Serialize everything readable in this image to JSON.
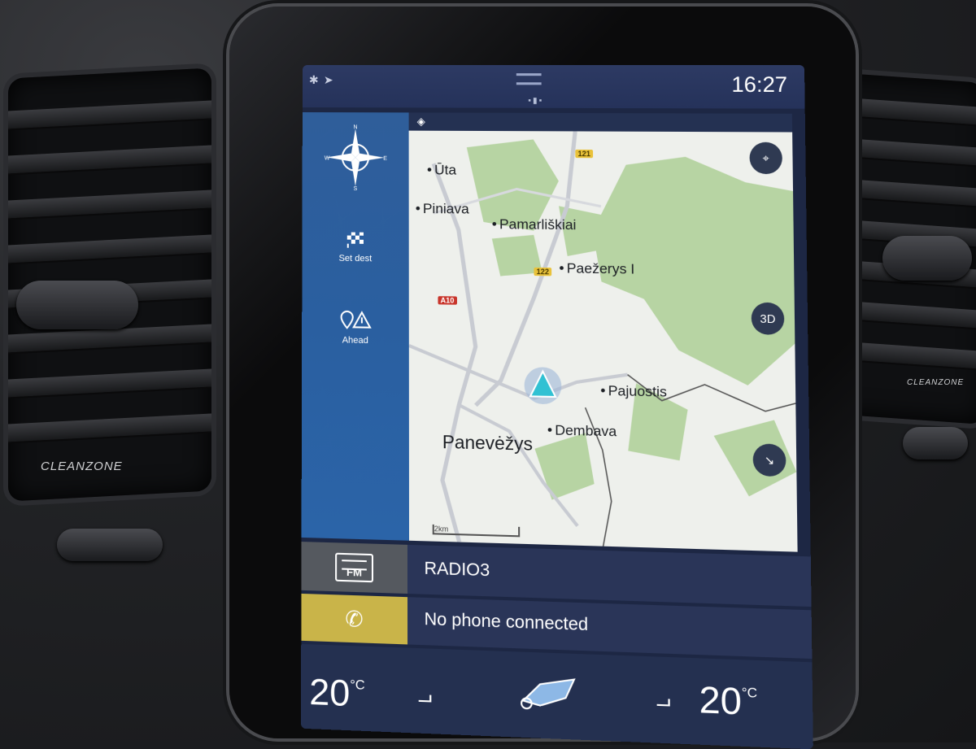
{
  "status": {
    "time": "16:27",
    "icons": [
      "bluetooth-icon",
      "location-arrow-icon"
    ]
  },
  "sidebar": {
    "compass": {
      "n": "N",
      "s": "S",
      "e": "E",
      "w": "W"
    },
    "set_dest_label": "Set dest",
    "ahead_label": "Ahead"
  },
  "map": {
    "places": {
      "uta": "Ūta",
      "piniava": "Piniava",
      "pamarliskiai": "Pamarliškiai",
      "paezerys": "Paežerys I",
      "pajuostis": "Pajuostis",
      "dembava": "Dembava",
      "panevezys": "Panevėžys"
    },
    "roads": {
      "r1": "121",
      "r2": "122",
      "r3": "A10"
    },
    "buttons": {
      "view_3d": "3D"
    },
    "scale": "2km"
  },
  "radio": {
    "station": "RADIO3",
    "band": "FM"
  },
  "phone": {
    "status": "No phone connected"
  },
  "climate": {
    "left_temp": "20",
    "right_temp": "20",
    "unit": "°C"
  },
  "dash": {
    "brand_left": "CLEANZONE",
    "brand_right": "CLEANZONE"
  },
  "colors": {
    "sidebar": "#2b5fa0",
    "phone_accent": "#c9b449",
    "map_green": "#b7d4a3"
  }
}
